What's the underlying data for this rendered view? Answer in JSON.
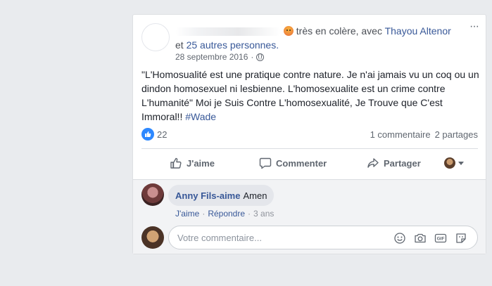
{
  "header": {
    "feeling_text": "très en colère, avec",
    "tagged_name": "Thayou Altenor",
    "and_text": "et",
    "others_link": "25 autres personnes.",
    "date": "28 septembre 2016",
    "separator": "·"
  },
  "post": {
    "text": "\"L'Homosualité est une pratique contre nature. Je n'ai jamais vu un coq ou un dindon homosexuel ni lesbienne. L'homosexualite est un crime contre L'humanité\" Moi je Suis Contre L'homosexualité, Je Trouve que C'est Immoral!! ",
    "hashtag": "#Wade"
  },
  "stats": {
    "likes": "22",
    "comments": "1 commentaire",
    "shares": "2 partages"
  },
  "actions": {
    "like": "J'aime",
    "comment": "Commenter",
    "share": "Partager"
  },
  "comment": {
    "author": "Anny Fils-aime",
    "text": "Amen",
    "like": "J'aime",
    "reply": "Répondre",
    "sep": "·",
    "age": "3 ans"
  },
  "reply_box": {
    "placeholder": "Votre commentaire..."
  },
  "colors": {
    "link": "#385898",
    "like_blue": "#2d88ff",
    "background": "#e9ebee"
  }
}
